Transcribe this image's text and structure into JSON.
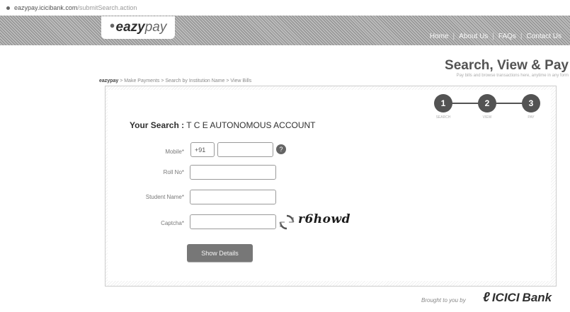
{
  "browser": {
    "url_domain": "eazypay.icicibank.com",
    "url_path": "/submitSearch.action"
  },
  "header": {
    "logo_text_bold": "eazy",
    "logo_text_light": "pay",
    "nav": [
      "Home",
      "About Us",
      "FAQs",
      "Contact Us"
    ]
  },
  "breadcrumb": {
    "root": "eazypay",
    "rest": " > Make Payments > Search by Institution Name > View Bills"
  },
  "page": {
    "title": "Search, View & Pay",
    "tagline": "Pay bills and browse transactions here, anytime in any form"
  },
  "steps": [
    {
      "number": "1",
      "label": "SEARCH"
    },
    {
      "number": "2",
      "label": "VIEW"
    },
    {
      "number": "3",
      "label": "PAY"
    }
  ],
  "search": {
    "label": "Your Search :",
    "value": "T C E AUTONOMOUS ACCOUNT"
  },
  "form": {
    "mobile_label": "Mobile*",
    "mobile_prefix": "+91",
    "mobile_value": "",
    "rollno_label": "Roll No*",
    "rollno_value": "",
    "student_label": "Student Name*",
    "student_value": "",
    "captcha_label": "Captcha*",
    "captcha_value": "",
    "captcha_text": "r6howd",
    "help_glyph": "?",
    "submit_label": "Show Details"
  },
  "footer": {
    "brought_by": "Brought to you by",
    "bank_name": "ICICI",
    "bank_suffix": "Bank"
  }
}
